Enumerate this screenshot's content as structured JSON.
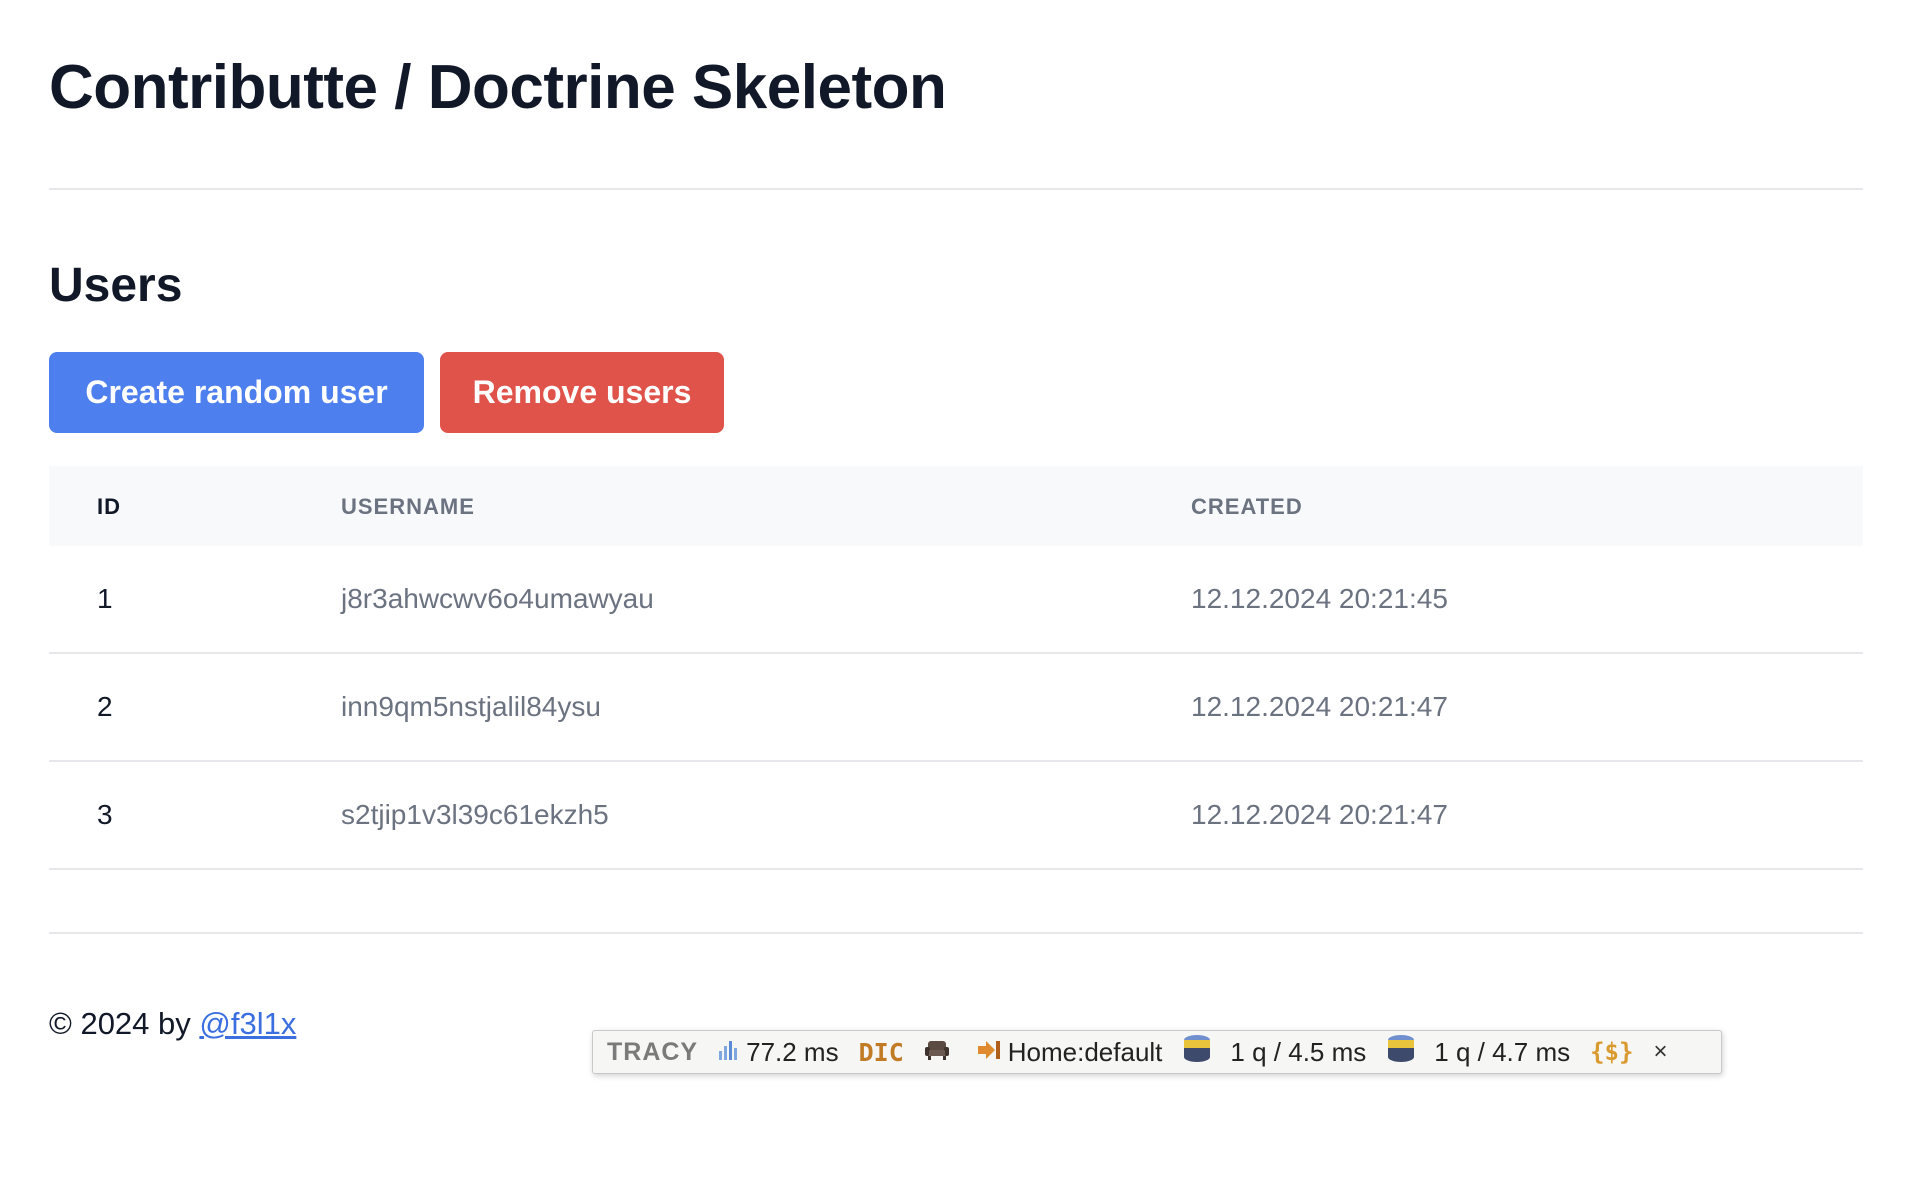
{
  "header": {
    "title": "Contributte / Doctrine Skeleton"
  },
  "section": {
    "title": "Users"
  },
  "actions": {
    "create_label": "Create random user",
    "remove_label": "Remove users"
  },
  "colors": {
    "primary": "#4e7fee",
    "danger": "#e0534b",
    "link": "#3b6fe0"
  },
  "table": {
    "columns": [
      "ID",
      "USERNAME",
      "CREATED"
    ],
    "rows": [
      {
        "id": "1",
        "username": "j8r3ahwcwv6o4umawyau",
        "created": "12.12.2024 20:21:45"
      },
      {
        "id": "2",
        "username": "inn9qm5nstjalil84ysu",
        "created": "12.12.2024 20:21:47"
      },
      {
        "id": "3",
        "username": "s2tjip1v3l39c61ekzh5",
        "created": "12.12.2024 20:21:47"
      }
    ]
  },
  "footer": {
    "prefix": "© 2024 by ",
    "link_text": "@f3l1x"
  },
  "tracy": {
    "logo": "TRACY",
    "time": "77.2 ms",
    "dic": "DIC",
    "route": "Home:default",
    "db1": "1 q / 4.5 ms",
    "db2": "1 q / 4.7 ms",
    "vars": "{$}",
    "close": "×",
    "icons": [
      "bar-chart-icon",
      "dic-icon",
      "armchair-icon",
      "login-arrow-icon",
      "database-icon",
      "database-icon",
      "variables-icon",
      "close-icon"
    ]
  }
}
